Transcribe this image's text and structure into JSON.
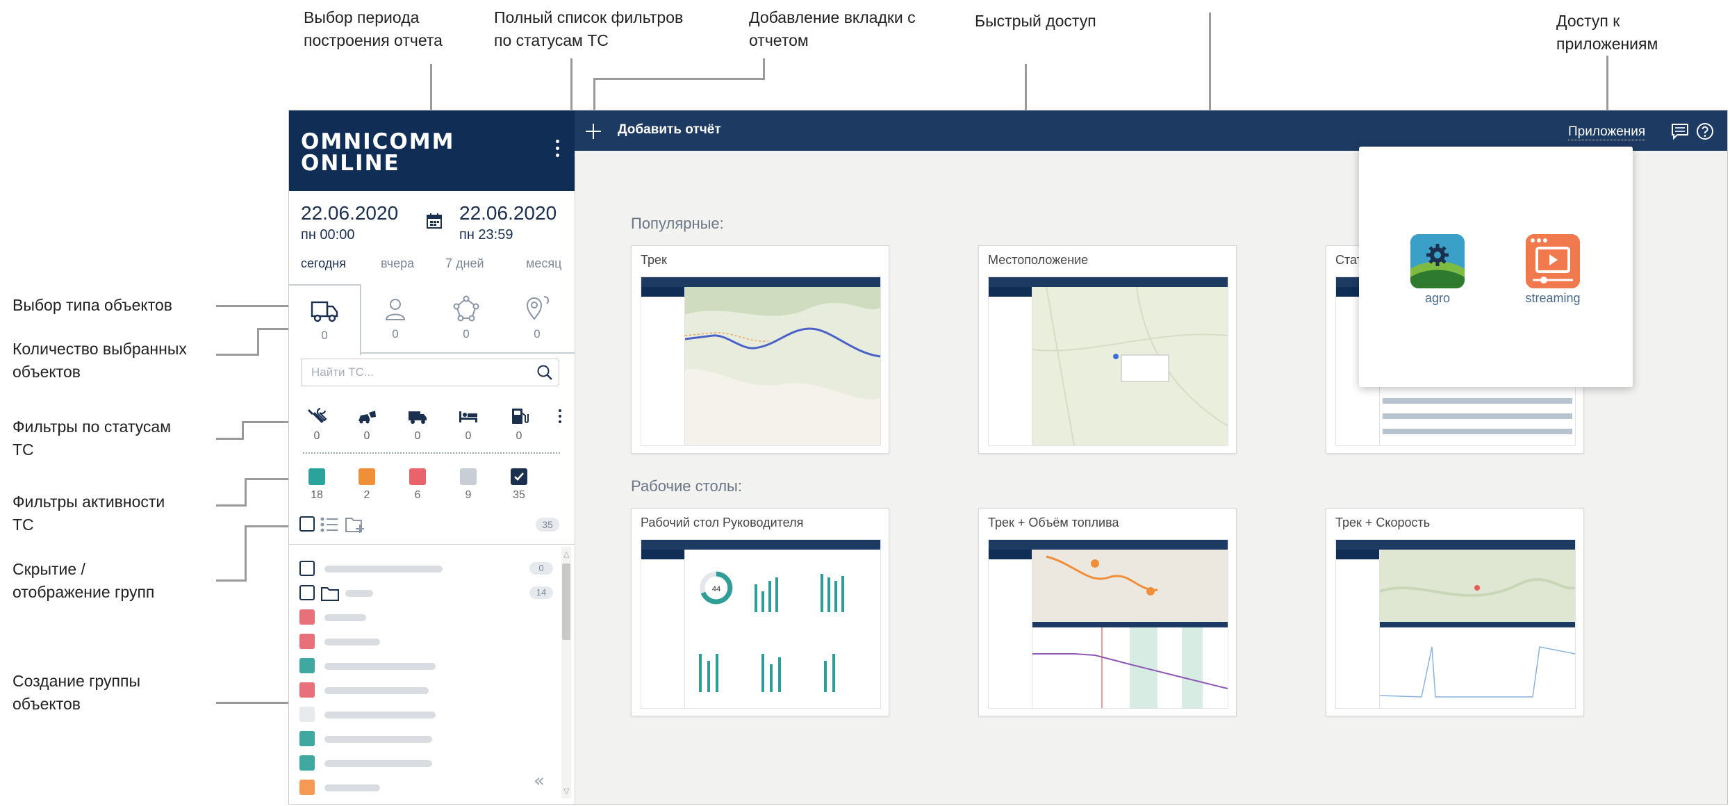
{
  "annotations": {
    "period_selection": "Выбор периода\nпостроения отчета",
    "status_filters_full": "Полный список фильтров\nпо статусам ТС",
    "add_report_tab": "Добавление вкладки с\nотчетом",
    "quick_access": "Быстрый доступ",
    "apps_access": "Доступ к\nприложениям",
    "object_type": "Выбор типа объектов",
    "selected_count": "Количество выбранных\nобъектов",
    "status_filters": "Фильтры по статусам\nТС",
    "activity_filters": "Фильтры активности\nТС",
    "groups_toggle": "Скрытие /\nотображение групп",
    "create_group": "Создание группы\nобъектов"
  },
  "sidebar": {
    "logo": "OMNICOMM\nONLINE",
    "date_from": "22.06.2020",
    "time_from": "пн 00:00",
    "date_to": "22.06.2020",
    "time_to": "пн 23:59",
    "periods": [
      "сегодня",
      "вчера",
      "7 дней",
      "месяц"
    ],
    "object_tabs": [
      {
        "icon": "truck-icon",
        "count": "0"
      },
      {
        "icon": "person-icon",
        "count": "0"
      },
      {
        "icon": "network-icon",
        "count": "0"
      },
      {
        "icon": "geofence-icon",
        "count": "0"
      }
    ],
    "search_placeholder": "Найти ТС...",
    "status_filters": [
      {
        "icon": "repair-icon",
        "count": "0"
      },
      {
        "icon": "accident-icon",
        "count": "0"
      },
      {
        "icon": "moving-truck-icon",
        "count": "0"
      },
      {
        "icon": "parking-bed-icon",
        "count": "0"
      },
      {
        "icon": "fuel-station-icon",
        "count": "0"
      }
    ],
    "activity_filters": [
      {
        "color": "#2aa39b",
        "count": "18"
      },
      {
        "color": "#f08f3a",
        "count": "2"
      },
      {
        "color": "#e8636b",
        "count": "6"
      },
      {
        "color": "#c9ced6",
        "count": "9"
      },
      {
        "color": "#1b2f4f",
        "count": "35",
        "checked": true
      }
    ],
    "total_count": "35",
    "group_rows": [
      {
        "kind": "check",
        "badge": "0"
      },
      {
        "kind": "folder",
        "badge": "14"
      },
      {
        "kind": "color",
        "color": "#e8707a"
      },
      {
        "kind": "color",
        "color": "#e8707a"
      },
      {
        "kind": "color",
        "color": "#3fa8a0"
      },
      {
        "kind": "color",
        "color": "#e8707a"
      },
      {
        "kind": "color",
        "color": "#e8ebee"
      },
      {
        "kind": "color",
        "color": "#3fa8a0"
      },
      {
        "kind": "color",
        "color": "#3fa8a0"
      },
      {
        "kind": "color",
        "color": "#f59a55"
      }
    ]
  },
  "topbar": {
    "add_report": "Добавить отчёт",
    "apps": "Приложения"
  },
  "main": {
    "popular_title": "Популярные:",
    "desktops_title": "Рабочие столы:",
    "popular_cards": [
      "Трек",
      "Местоположение",
      "Стат"
    ],
    "desktop_cards": [
      "Рабочий стол Руководителя",
      "Трек + Объём топлива",
      "Трек + Скорость"
    ],
    "thumb_gauge_value": "44"
  },
  "apps_popup": {
    "items": [
      {
        "label": "agro",
        "icon": "agro-icon"
      },
      {
        "label": "streaming",
        "icon": "streaming-icon"
      }
    ]
  },
  "colors": {
    "navy": "#0f2d55",
    "header": "#1c3a62",
    "teal": "#2aa39b",
    "orange": "#f08f3a",
    "red": "#e8636b",
    "grey": "#c9ced6"
  }
}
